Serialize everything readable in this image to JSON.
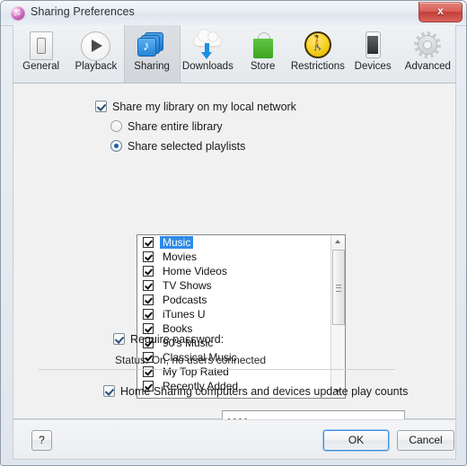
{
  "window": {
    "title": "Sharing Preferences",
    "title_icon": "itunes-note-icon",
    "close_label": "x"
  },
  "toolbar": {
    "tabs": [
      {
        "label": "General",
        "icon": "general-icon",
        "selected": false
      },
      {
        "label": "Playback",
        "icon": "playback-icon",
        "selected": false
      },
      {
        "label": "Sharing",
        "icon": "sharing-icon",
        "selected": true
      },
      {
        "label": "Downloads",
        "icon": "downloads-icon",
        "selected": false
      },
      {
        "label": "Store",
        "icon": "store-icon",
        "selected": false
      },
      {
        "label": "Restrictions",
        "icon": "restrictions-icon",
        "selected": false
      },
      {
        "label": "Devices",
        "icon": "devices-icon",
        "selected": false
      },
      {
        "label": "Advanced",
        "icon": "advanced-icon",
        "selected": false
      }
    ]
  },
  "main": {
    "share_library_label": "Share my library on my local network",
    "share_library_checked": true,
    "share_entire_label": "Share entire library",
    "share_selected_label": "Share selected playlists",
    "selected_option": "share_selected",
    "playlists": [
      {
        "name": "Music",
        "checked": true,
        "highlighted": true
      },
      {
        "name": "Movies",
        "checked": true,
        "highlighted": false
      },
      {
        "name": "Home Videos",
        "checked": true,
        "highlighted": false
      },
      {
        "name": "TV Shows",
        "checked": true,
        "highlighted": false
      },
      {
        "name": "Podcasts",
        "checked": true,
        "highlighted": false
      },
      {
        "name": "iTunes U",
        "checked": true,
        "highlighted": false
      },
      {
        "name": "Books",
        "checked": true,
        "highlighted": false
      },
      {
        "name": "90's Music",
        "checked": true,
        "highlighted": false
      },
      {
        "name": "Classical Music",
        "checked": true,
        "highlighted": false
      },
      {
        "name": "My Top Rated",
        "checked": true,
        "highlighted": false
      },
      {
        "name": "Recently Added",
        "checked": true,
        "highlighted": false
      }
    ],
    "require_password_label": "Require password:",
    "require_password_checked": true,
    "password_value": "••••",
    "status_text": "Status: On, no users connected",
    "home_sharing_label": "Home Sharing computers and devices update play counts",
    "home_sharing_checked": true
  },
  "footer": {
    "help_label": "?",
    "ok_label": "OK",
    "cancel_label": "Cancel"
  },
  "colors": {
    "selection_blue": "#2f8ae8",
    "accent_focus": "#3c8dde",
    "close_red": "#c33f38"
  }
}
